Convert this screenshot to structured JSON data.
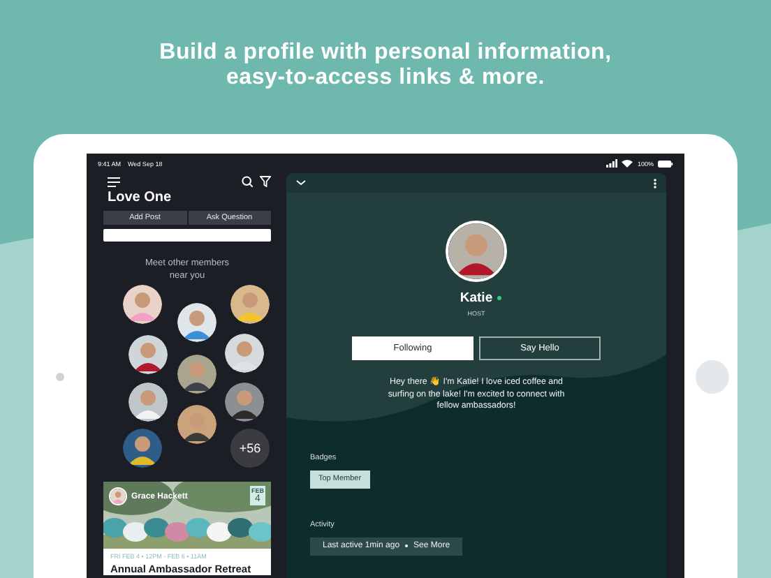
{
  "headline": "Build a profile with personal information, easy-to-access links & more.",
  "status_bar": {
    "time": "9:41 AM",
    "date": "Wed Sep 18",
    "battery": "100%"
  },
  "sidebar": {
    "title": "Love One",
    "actions": [
      "Add Post",
      "Ask Question"
    ],
    "members_heading": "Meet other members near you",
    "members": [
      {
        "kind": "avatar"
      },
      {
        "kind": "avatar"
      },
      {
        "kind": "avatar"
      },
      {
        "kind": "avatar"
      },
      {
        "kind": "avatar"
      },
      {
        "kind": "avatar"
      },
      {
        "kind": "avatar"
      },
      {
        "kind": "avatar"
      },
      {
        "kind": "avatar"
      },
      {
        "kind": "avatar"
      },
      {
        "kind": "count",
        "label": "+56"
      }
    ],
    "event": {
      "host": "Grace Hackett",
      "month": "FEB",
      "day": "4",
      "when": "FRI FEB 4 • 12PM - FEB 6 • 11AM",
      "title": "Annual Ambassador Retreat"
    }
  },
  "profile": {
    "name": "Katie",
    "online": true,
    "role": "HOST",
    "buttons": [
      {
        "label": "Following",
        "selected": true
      },
      {
        "label": "Say Hello",
        "selected": false
      }
    ],
    "bio": "Hey there 👋 I'm Katie! I love iced coffee and surfing on the lake! I'm excited to connect with fellow ambassadors!",
    "badges_label": "Badges",
    "badges": [
      "Top Member"
    ],
    "activity_label": "Activity",
    "activity": "Last active 1min ago",
    "activity_link": "See More"
  }
}
